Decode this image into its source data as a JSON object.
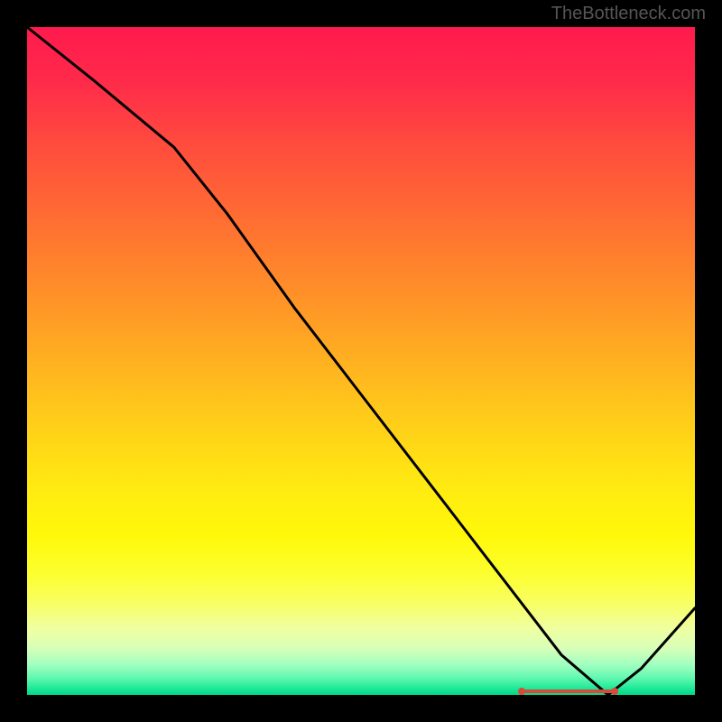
{
  "watermark": "TheBottleneck.com",
  "chart_data": {
    "type": "line",
    "title": "",
    "xlabel": "",
    "ylabel": "",
    "xlim": [
      0,
      100
    ],
    "ylim": [
      0,
      100
    ],
    "grid": false,
    "legend": false,
    "background": "rainbow-vertical-gradient",
    "series": [
      {
        "name": "bottleneck-curve",
        "x": [
          0,
          10,
          22,
          30,
          40,
          50,
          60,
          70,
          80,
          87,
          92,
          100
        ],
        "values": [
          100,
          92,
          82,
          72,
          58,
          45,
          32,
          19,
          6,
          0,
          4,
          13
        ]
      }
    ],
    "marker": {
      "x_start": 74,
      "x_end": 88,
      "y": 0,
      "label": ""
    },
    "gradient_stops": [
      {
        "pos": 0,
        "color": "#ff1a4d"
      },
      {
        "pos": 0.18,
        "color": "#ff4d3d"
      },
      {
        "pos": 0.38,
        "color": "#ff8a2a"
      },
      {
        "pos": 0.58,
        "color": "#ffca1a"
      },
      {
        "pos": 0.76,
        "color": "#fff80a"
      },
      {
        "pos": 0.9,
        "color": "#f0ffa0"
      },
      {
        "pos": 0.96,
        "color": "#80f8b8"
      },
      {
        "pos": 1.0,
        "color": "#00d88a"
      }
    ]
  }
}
